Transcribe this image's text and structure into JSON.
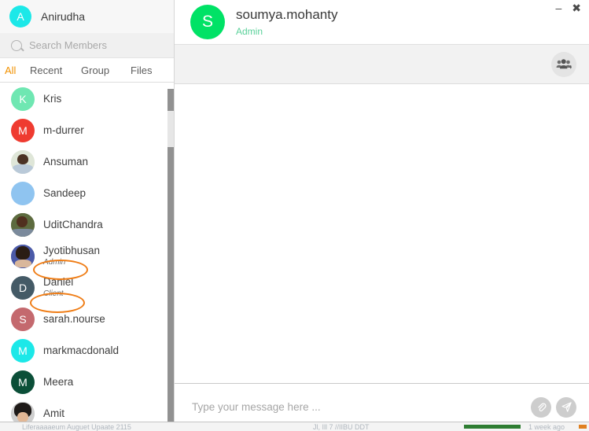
{
  "app": {
    "accent_orange": "#f29100",
    "annotation_color": "#ef7d16"
  },
  "sidebar": {
    "profile": {
      "name": "Anirudha",
      "avatar_letter": "A",
      "avatar_color": "#1ce8e8"
    },
    "search": {
      "placeholder": "Search Members",
      "value": "",
      "icon": "search-icon"
    },
    "tabs": [
      {
        "label": "All",
        "active": true
      },
      {
        "label": "Recent",
        "active": false
      },
      {
        "label": "Group",
        "active": false
      },
      {
        "label": "Files",
        "active": false
      }
    ],
    "contacts": [
      {
        "name": "Kris",
        "role": "",
        "avatar_letter": "K",
        "avatar_color": "#6fe7b2",
        "photo": ""
      },
      {
        "name": "m-durrer",
        "role": "",
        "avatar_letter": "M",
        "avatar_color": "#ef3b30",
        "photo": ""
      },
      {
        "name": "Ansuman",
        "role": "",
        "avatar_letter": "",
        "avatar_color": "#dfe6d8",
        "photo": "ph-ansuman"
      },
      {
        "name": "Sandeep",
        "role": "",
        "avatar_letter": "",
        "avatar_color": "#8fc4f0",
        "photo": ""
      },
      {
        "name": "UditChandra",
        "role": "",
        "avatar_letter": "",
        "avatar_color": "#5d6b3f",
        "photo": "ph-udit"
      },
      {
        "name": "Jyotibhusan",
        "role": "Admin",
        "avatar_letter": "",
        "avatar_color": "#4b5aa8",
        "photo": "ph-jyoti"
      },
      {
        "name": "Daniel",
        "role": "Client",
        "avatar_letter": "D",
        "avatar_color": "#445a66",
        "photo": ""
      },
      {
        "name": "sarah.nourse",
        "role": "",
        "avatar_letter": "S",
        "avatar_color": "#c4696e",
        "photo": ""
      },
      {
        "name": "markmacdonald",
        "role": "",
        "avatar_letter": "M",
        "avatar_color": "#1ce8e8",
        "photo": ""
      },
      {
        "name": "Meera",
        "role": "",
        "avatar_letter": "M",
        "avatar_color": "#0b4f38",
        "photo": ""
      },
      {
        "name": "Amit",
        "role": "",
        "avatar_letter": "",
        "avatar_color": "#cfcfcf",
        "photo": "ph-amit"
      }
    ]
  },
  "chat": {
    "header": {
      "avatar_letter": "S",
      "avatar_color": "#00e266",
      "title": "soumya.mohanty",
      "subtitle": "Admin",
      "subtitle_color": "#5ad19a",
      "minimize_glyph": "–",
      "close_glyph": "✖"
    },
    "toolbar": {
      "add_members_icon": "add-group-members-icon"
    },
    "messages": [],
    "composer": {
      "placeholder": "Type your message here ...",
      "value": "",
      "attach_icon": "paperclip-icon",
      "send_icon": "send-paper-plane-icon"
    }
  },
  "background_window": {
    "text_left": "Liferaaaaeum Auguet Upaate 2115",
    "text_mid": "Jl,    Ill     7    //IIBU DDT",
    "text_right": "1 week ago"
  }
}
